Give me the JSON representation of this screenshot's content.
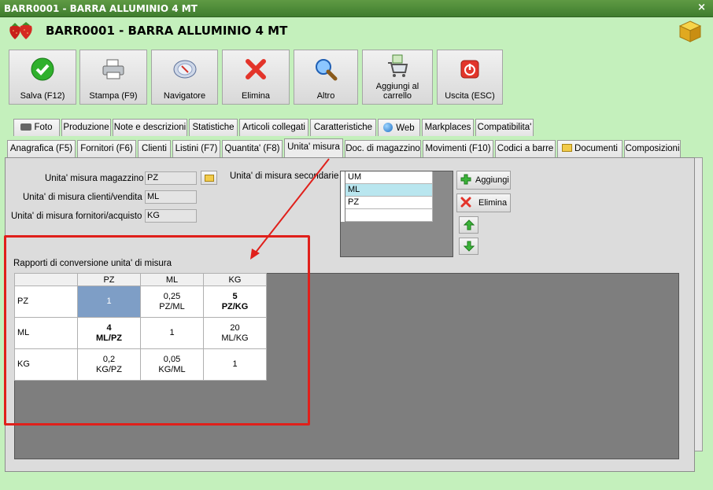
{
  "window": {
    "title": "BARR0001 - BARRA ALLUMINIO 4 MT",
    "close": "×"
  },
  "header": {
    "title": "BARR0001 - BARRA ALLUMINIO 4 MT"
  },
  "toolbar": [
    {
      "label": "Salva (F12)",
      "icon": "check-icon"
    },
    {
      "label": "Stampa (F9)",
      "icon": "printer-icon"
    },
    {
      "label": "Navigatore",
      "icon": "compass-icon"
    },
    {
      "label": "Elimina",
      "icon": "delete-x-icon"
    },
    {
      "label": "Altro",
      "icon": "magnifier-icon"
    },
    {
      "label": "Aggiungi al carrello",
      "icon": "cart-icon"
    },
    {
      "label": "Uscita (ESC)",
      "icon": "exit-icon"
    }
  ],
  "tabs_row1": [
    "Foto",
    "Produzione",
    "Note e descrizioni",
    "Statistiche",
    "Articoli collegati",
    "Caratteristiche",
    "Web",
    "Markplaces",
    "Compatibilita'"
  ],
  "tabs_row2": [
    "Anagrafica (F5)",
    "Fornitori (F6)",
    "Clienti",
    "Listini (F7)",
    "Quantita' (F8)",
    "Unita' misura",
    "Doc. di magazzino",
    "Movimenti (F10)",
    "Codici a barre",
    "Documenti",
    "Composizioni"
  ],
  "form": {
    "um_magazzino_label": "Unita' misura magazzino :",
    "um_magazzino_value": "PZ",
    "um_clienti_label": "Unita' di misura clienti/vendita :",
    "um_clienti_value": "ML",
    "um_fornitori_label": "Unita' di misura fornitori/acquisto :",
    "um_fornitori_value": "KG",
    "um_secondarie_label": "Unita' di misura secondarie :"
  },
  "secondary_units": {
    "header": "UM",
    "items": [
      "ML",
      "PZ"
    ],
    "selected": "ML"
  },
  "side_buttons": {
    "add": "Aggiungi",
    "delete": "Elimina"
  },
  "conversion": {
    "title": "Rapporti di conversione unita' di misura",
    "columns": [
      "PZ",
      "ML",
      "KG"
    ],
    "rows": [
      {
        "label": "PZ",
        "cells": [
          "1",
          "0,25\nPZ/ML",
          "5\nPZ/KG"
        ]
      },
      {
        "label": "ML",
        "cells": [
          "4\nML/PZ",
          "1",
          "20\nML/KG"
        ]
      },
      {
        "label": "KG",
        "cells": [
          "0,2\nKG/PZ",
          "0,05\nKG/ML",
          "1"
        ]
      }
    ]
  },
  "colors": {
    "background": "#c4f0bc",
    "titlebar": "#4a8a36",
    "highlight": "#e0201b",
    "selected_cell": "#7e9ec6"
  }
}
